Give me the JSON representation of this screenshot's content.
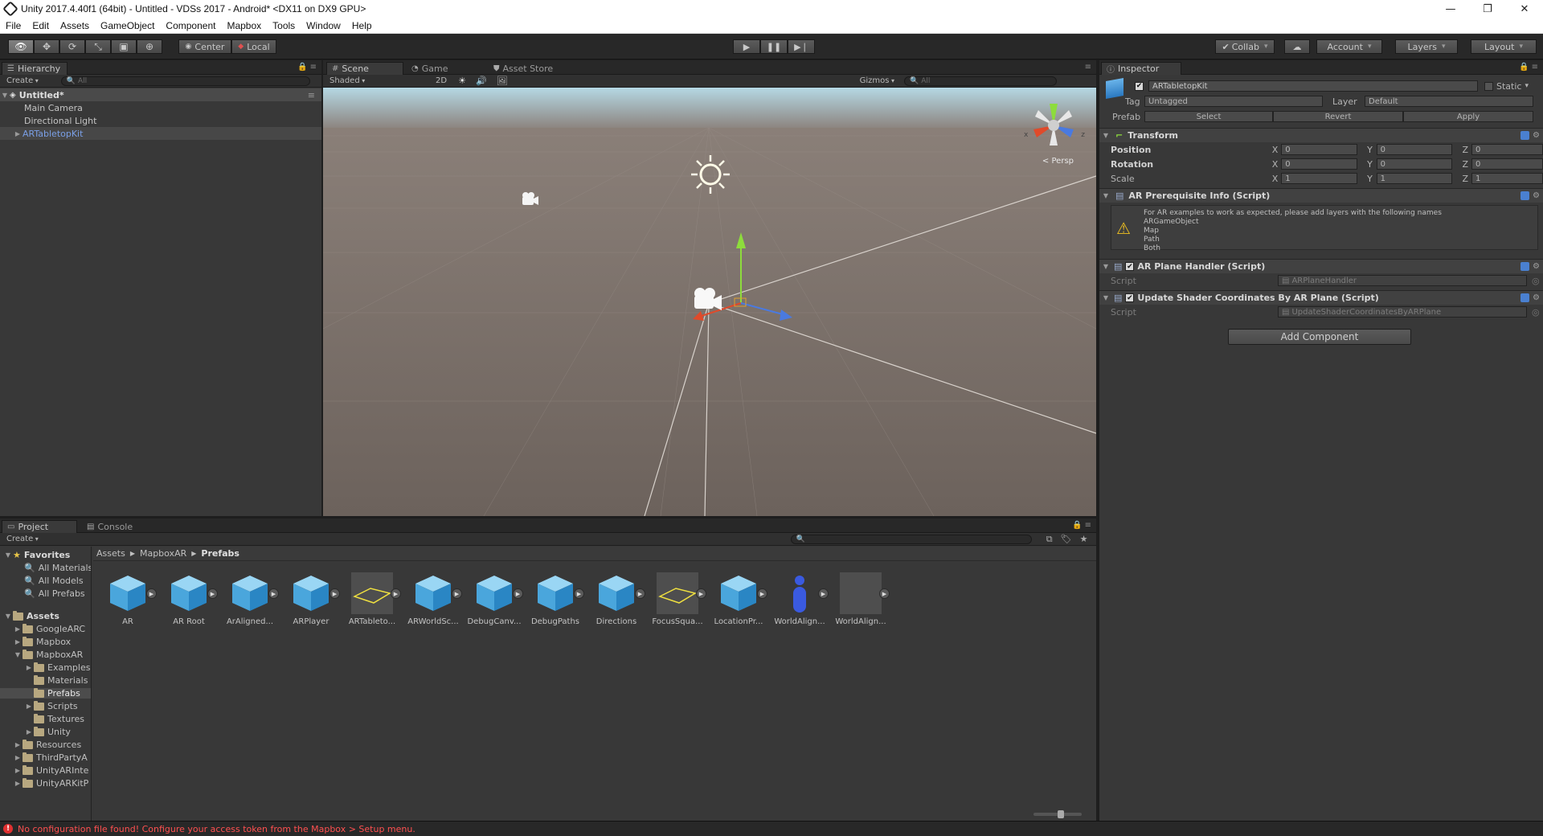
{
  "window": {
    "title": "Unity 2017.4.40f1 (64bit) - Untitled - VDSs 2017 - Android* <DX11 on DX9 GPU>",
    "controls": [
      "—",
      "❐",
      "✕"
    ]
  },
  "menu": [
    "File",
    "Edit",
    "Assets",
    "GameObject",
    "Component",
    "Mapbox",
    "Tools",
    "Window",
    "Help"
  ],
  "toolbar": {
    "pivot": "Center",
    "space": "Local",
    "collab": "Collab",
    "account": "Account",
    "layers": "Layers",
    "layout": "Layout"
  },
  "hierarchy": {
    "tab": "Hierarchy",
    "create": "Create",
    "search_placeholder": "All",
    "scene": "Untitled*",
    "items": [
      "Main Camera",
      "Directional Light",
      "ARTabletopKit"
    ]
  },
  "scene_view": {
    "tabs": [
      "Scene",
      "Game",
      "Asset Store"
    ],
    "shading": "Shaded",
    "mode_2d": "2D",
    "gizmos": "Gizmos",
    "search_placeholder": "All",
    "persp": "Persp",
    "gizmo_axes": [
      "x",
      "z"
    ]
  },
  "inspector": {
    "tab": "Inspector",
    "object_name": "ARTabletopKit",
    "static_label": "Static",
    "tag_label": "Tag",
    "tag_value": "Untagged",
    "layer_label": "Layer",
    "layer_value": "Default",
    "prefab_label": "Prefab",
    "prefab_select": "Select",
    "prefab_revert": "Revert",
    "prefab_apply": "Apply",
    "transform": {
      "title": "Transform",
      "position_label": "Position",
      "rotation_label": "Rotation",
      "scale_label": "Scale",
      "position": [
        "0",
        "0",
        "0"
      ],
      "rotation": [
        "0",
        "0",
        "0"
      ],
      "scale": [
        "1",
        "1",
        "1"
      ],
      "axes": [
        "X",
        "Y",
        "Z"
      ]
    },
    "prereq": {
      "title": "AR Prerequisite Info (Script)",
      "message": "For AR examples to work as expected, please add layers with the following names",
      "layers": [
        "ARGameObject",
        "Map",
        "Path",
        "Both"
      ]
    },
    "plane_handler": {
      "title": "AR Plane Handler (Script)",
      "script_label": "Script",
      "script_value": "ARPlaneHandler"
    },
    "shader_coords": {
      "title": "Update Shader Coordinates By AR Plane (Script)",
      "script_label": "Script",
      "script_value": "UpdateShaderCoordinatesByARPlane"
    },
    "add_component": "Add Component"
  },
  "project": {
    "tabs": [
      "Project",
      "Console"
    ],
    "create": "Create",
    "favorites_label": "Favorites",
    "favorites": [
      "All Materials",
      "All Models",
      "All Prefabs"
    ],
    "assets_label": "Assets",
    "tree": [
      {
        "label": "GoogleARC",
        "depth": 1,
        "expander": "▶"
      },
      {
        "label": "Mapbox",
        "depth": 1,
        "expander": "▶"
      },
      {
        "label": "MapboxAR",
        "depth": 1,
        "expander": "▼"
      },
      {
        "label": "Examples",
        "depth": 2,
        "expander": "▶"
      },
      {
        "label": "Materials",
        "depth": 2,
        "expander": ""
      },
      {
        "label": "Prefabs",
        "depth": 2,
        "expander": "",
        "selected": true
      },
      {
        "label": "Scripts",
        "depth": 2,
        "expander": "▶"
      },
      {
        "label": "Textures",
        "depth": 2,
        "expander": ""
      },
      {
        "label": "Unity",
        "depth": 2,
        "expander": "▶"
      },
      {
        "label": "Resources",
        "depth": 1,
        "expander": "▶"
      },
      {
        "label": "ThirdPartyA",
        "depth": 1,
        "expander": "▶"
      },
      {
        "label": "UnityARInte",
        "depth": 1,
        "expander": "▶"
      },
      {
        "label": "UnityARKitP",
        "depth": 1,
        "expander": "▶"
      }
    ],
    "breadcrumb": [
      "Assets",
      "MapboxAR",
      "Prefabs"
    ],
    "assets": [
      {
        "label": "AR",
        "kind": "cube"
      },
      {
        "label": "AR Root",
        "kind": "cube"
      },
      {
        "label": "ArAligned...",
        "kind": "cube"
      },
      {
        "label": "ARPlayer",
        "kind": "cube"
      },
      {
        "label": "ARTableto...",
        "kind": "plane"
      },
      {
        "label": "ARWorldSc...",
        "kind": "cube"
      },
      {
        "label": "DebugCanv...",
        "kind": "cube"
      },
      {
        "label": "DebugPaths",
        "kind": "cube"
      },
      {
        "label": "Directions",
        "kind": "cube"
      },
      {
        "label": "FocusSqua...",
        "kind": "plane"
      },
      {
        "label": "LocationPr...",
        "kind": "cube"
      },
      {
        "label": "WorldAlign...",
        "kind": "capsule"
      },
      {
        "label": "WorldAlign...",
        "kind": "empty"
      }
    ]
  },
  "status": {
    "message": "No configuration file found! Configure your access token from the Mapbox > Setup menu."
  },
  "colors": {
    "accent_blue": "#4a80d0",
    "selection_text": "#7a9fe6",
    "error": "#ff5050"
  }
}
